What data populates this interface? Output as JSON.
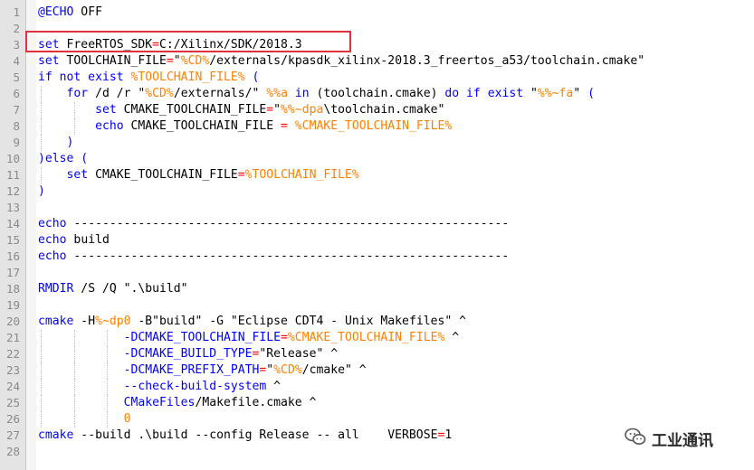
{
  "editor": {
    "lines": [
      {
        "n": "1",
        "tokens": [
          {
            "t": "@ECHO",
            "c": "kw"
          },
          {
            "t": " OFF",
            "c": ""
          }
        ]
      },
      {
        "n": "2",
        "tokens": []
      },
      {
        "n": "3",
        "tokens": [
          {
            "t": "set",
            "c": "kw"
          },
          {
            "t": " FreeRTOS_SDK",
            "c": ""
          },
          {
            "t": "=",
            "c": "op"
          },
          {
            "t": "C:/Xilinx/SDK/2018.3",
            "c": ""
          }
        ]
      },
      {
        "n": "4",
        "tokens": [
          {
            "t": "set",
            "c": "kw"
          },
          {
            "t": " TOOLCHAIN_FILE",
            "c": ""
          },
          {
            "t": "=",
            "c": "op"
          },
          {
            "t": "\"",
            "c": ""
          },
          {
            "t": "%CD%",
            "c": "var"
          },
          {
            "t": "/externals/kpasdk_xilinx-2018.3_freertos_a53/toolchain.cmake\"",
            "c": ""
          }
        ]
      },
      {
        "n": "5",
        "tokens": [
          {
            "t": "if not exist",
            "c": "kw"
          },
          {
            "t": " ",
            "c": ""
          },
          {
            "t": "%TOOLCHAIN_FILE%",
            "c": "var"
          },
          {
            "t": " (",
            "c": "kw"
          }
        ]
      },
      {
        "n": "6",
        "indent": 1,
        "tokens": [
          {
            "t": "    for",
            "c": "kw"
          },
          {
            "t": " /d /r \"",
            "c": ""
          },
          {
            "t": "%CD%",
            "c": "var"
          },
          {
            "t": "/externals/\" ",
            "c": ""
          },
          {
            "t": "%%a",
            "c": "var"
          },
          {
            "t": " in",
            "c": "kw"
          },
          {
            "t": " (toolchain.cmake) ",
            "c": ""
          },
          {
            "t": "do if exist",
            "c": "kw"
          },
          {
            "t": " \"",
            "c": ""
          },
          {
            "t": "%%~fa",
            "c": "var"
          },
          {
            "t": "\"",
            "c": ""
          },
          {
            "t": " (",
            "c": "kw"
          }
        ]
      },
      {
        "n": "7",
        "indent": 2,
        "tokens": [
          {
            "t": "        set",
            "c": "kw"
          },
          {
            "t": " CMAKE_TOOLCHAIN_FILE",
            "c": ""
          },
          {
            "t": "=",
            "c": "op"
          },
          {
            "t": "\"",
            "c": ""
          },
          {
            "t": "%%~dpa",
            "c": "var"
          },
          {
            "t": "\\toolchain.cmake\"",
            "c": ""
          }
        ]
      },
      {
        "n": "8",
        "indent": 2,
        "tokens": [
          {
            "t": "        echo",
            "c": "kw"
          },
          {
            "t": " CMAKE_TOOLCHAIN_FILE ",
            "c": ""
          },
          {
            "t": "=",
            "c": "op"
          },
          {
            "t": " ",
            "c": ""
          },
          {
            "t": "%CMAKE_TOOLCHAIN_FILE%",
            "c": "var"
          }
        ]
      },
      {
        "n": "9",
        "indent": 1,
        "tokens": [
          {
            "t": "    )",
            "c": "kw"
          }
        ]
      },
      {
        "n": "10",
        "tokens": [
          {
            "t": ")else (",
            "c": "kw"
          }
        ]
      },
      {
        "n": "11",
        "indent": 1,
        "tokens": [
          {
            "t": "    set",
            "c": "kw"
          },
          {
            "t": " CMAKE_TOOLCHAIN_FILE",
            "c": ""
          },
          {
            "t": "=",
            "c": "op"
          },
          {
            "t": "%TOOLCHAIN_FILE%",
            "c": "var"
          }
        ]
      },
      {
        "n": "12",
        "tokens": [
          {
            "t": ")",
            "c": "kw"
          }
        ]
      },
      {
        "n": "13",
        "tokens": []
      },
      {
        "n": "14",
        "tokens": [
          {
            "t": "echo",
            "c": "kw"
          },
          {
            "t": " -------------------------------------------------------------",
            "c": ""
          }
        ]
      },
      {
        "n": "15",
        "tokens": [
          {
            "t": "echo",
            "c": "kw"
          },
          {
            "t": " build",
            "c": ""
          }
        ]
      },
      {
        "n": "16",
        "tokens": [
          {
            "t": "echo",
            "c": "kw"
          },
          {
            "t": " -------------------------------------------------------------",
            "c": ""
          }
        ]
      },
      {
        "n": "17",
        "tokens": []
      },
      {
        "n": "18",
        "tokens": [
          {
            "t": "RMDIR",
            "c": "kw"
          },
          {
            "t": " /S /Q \".\\build\"",
            "c": ""
          }
        ]
      },
      {
        "n": "19",
        "tokens": []
      },
      {
        "n": "20",
        "tokens": [
          {
            "t": "cmake",
            "c": "kw"
          },
          {
            "t": " -H",
            "c": ""
          },
          {
            "t": "%~dp0",
            "c": "var"
          },
          {
            "t": " -B\"build\" -G \"Eclipse CDT4 - Unix Makefiles\" ^",
            "c": ""
          }
        ]
      },
      {
        "n": "21",
        "indent": 3,
        "tokens": [
          {
            "t": "            -DCMAKE_TOOLCHAIN_FILE",
            "c": "kw"
          },
          {
            "t": "=",
            "c": "op"
          },
          {
            "t": "%CMAKE_TOOLCHAIN_FILE%",
            "c": "var"
          },
          {
            "t": " ^",
            "c": ""
          }
        ]
      },
      {
        "n": "22",
        "indent": 3,
        "tokens": [
          {
            "t": "            -DCMAKE_BUILD_TYPE",
            "c": "kw"
          },
          {
            "t": "=",
            "c": "op"
          },
          {
            "t": "\"Release\" ^",
            "c": ""
          }
        ]
      },
      {
        "n": "23",
        "indent": 3,
        "tokens": [
          {
            "t": "            -DCMAKE_PREFIX_PATH",
            "c": "kw"
          },
          {
            "t": "=",
            "c": "op"
          },
          {
            "t": "\"",
            "c": ""
          },
          {
            "t": "%CD%",
            "c": "var"
          },
          {
            "t": "/cmake\" ^",
            "c": ""
          }
        ]
      },
      {
        "n": "24",
        "indent": 3,
        "tokens": [
          {
            "t": "            --check-build-system",
            "c": "kw"
          },
          {
            "t": " ^",
            "c": ""
          }
        ]
      },
      {
        "n": "25",
        "indent": 3,
        "tokens": [
          {
            "t": "            CMakeFiles",
            "c": "kw"
          },
          {
            "t": "/Makefile.cmake ^",
            "c": ""
          }
        ]
      },
      {
        "n": "26",
        "indent": 3,
        "tokens": [
          {
            "t": "            0",
            "c": "num"
          }
        ]
      },
      {
        "n": "27",
        "tokens": [
          {
            "t": "cmake",
            "c": "kw"
          },
          {
            "t": " --build .\\build --config Release -- all    VERBOSE",
            "c": ""
          },
          {
            "t": "=",
            "c": "op"
          },
          {
            "t": "1",
            "c": ""
          }
        ]
      },
      {
        "n": "28",
        "tokens": []
      }
    ]
  },
  "watermark": {
    "text": "工业通讯",
    "icon": "wechat-icon"
  }
}
